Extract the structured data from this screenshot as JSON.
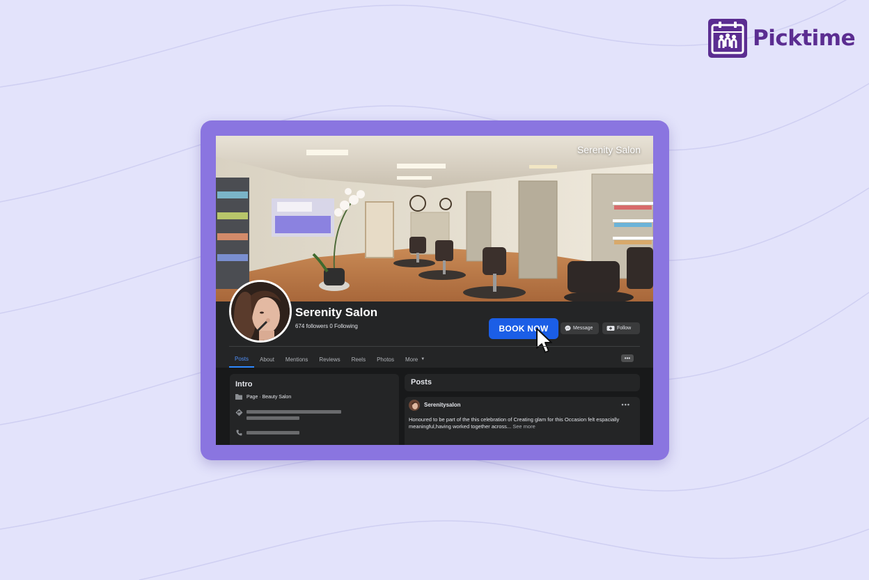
{
  "brand": {
    "name": "Picktime",
    "color": "#5b2d91"
  },
  "page": {
    "cover_title": "Serenity Salon",
    "name": "Serenity Salon",
    "stats": "674 followers 0 Following"
  },
  "actions": {
    "book_now": "BOOK NOW",
    "message": "Message",
    "follow": "Follow"
  },
  "tabs": [
    {
      "label": "Posts",
      "active": true
    },
    {
      "label": "About"
    },
    {
      "label": "Mentions"
    },
    {
      "label": "Reviews"
    },
    {
      "label": "Reels"
    },
    {
      "label": "Photos"
    },
    {
      "label": "More"
    }
  ],
  "intro": {
    "title": "Intro",
    "category": "Page · Beauty Salon"
  },
  "posts": {
    "title": "Posts",
    "author": "Serenitysalon",
    "text": "Honoured to be part of the this celebration of Creating  glam for this Occasion felt espacially meaningful,having worked together across... ",
    "see_more": "See more"
  },
  "colors": {
    "background": "#e3e3fb",
    "frame": "#8a75e0",
    "book_button": "#1b5ee6",
    "active_tab": "#4f8ff7"
  }
}
